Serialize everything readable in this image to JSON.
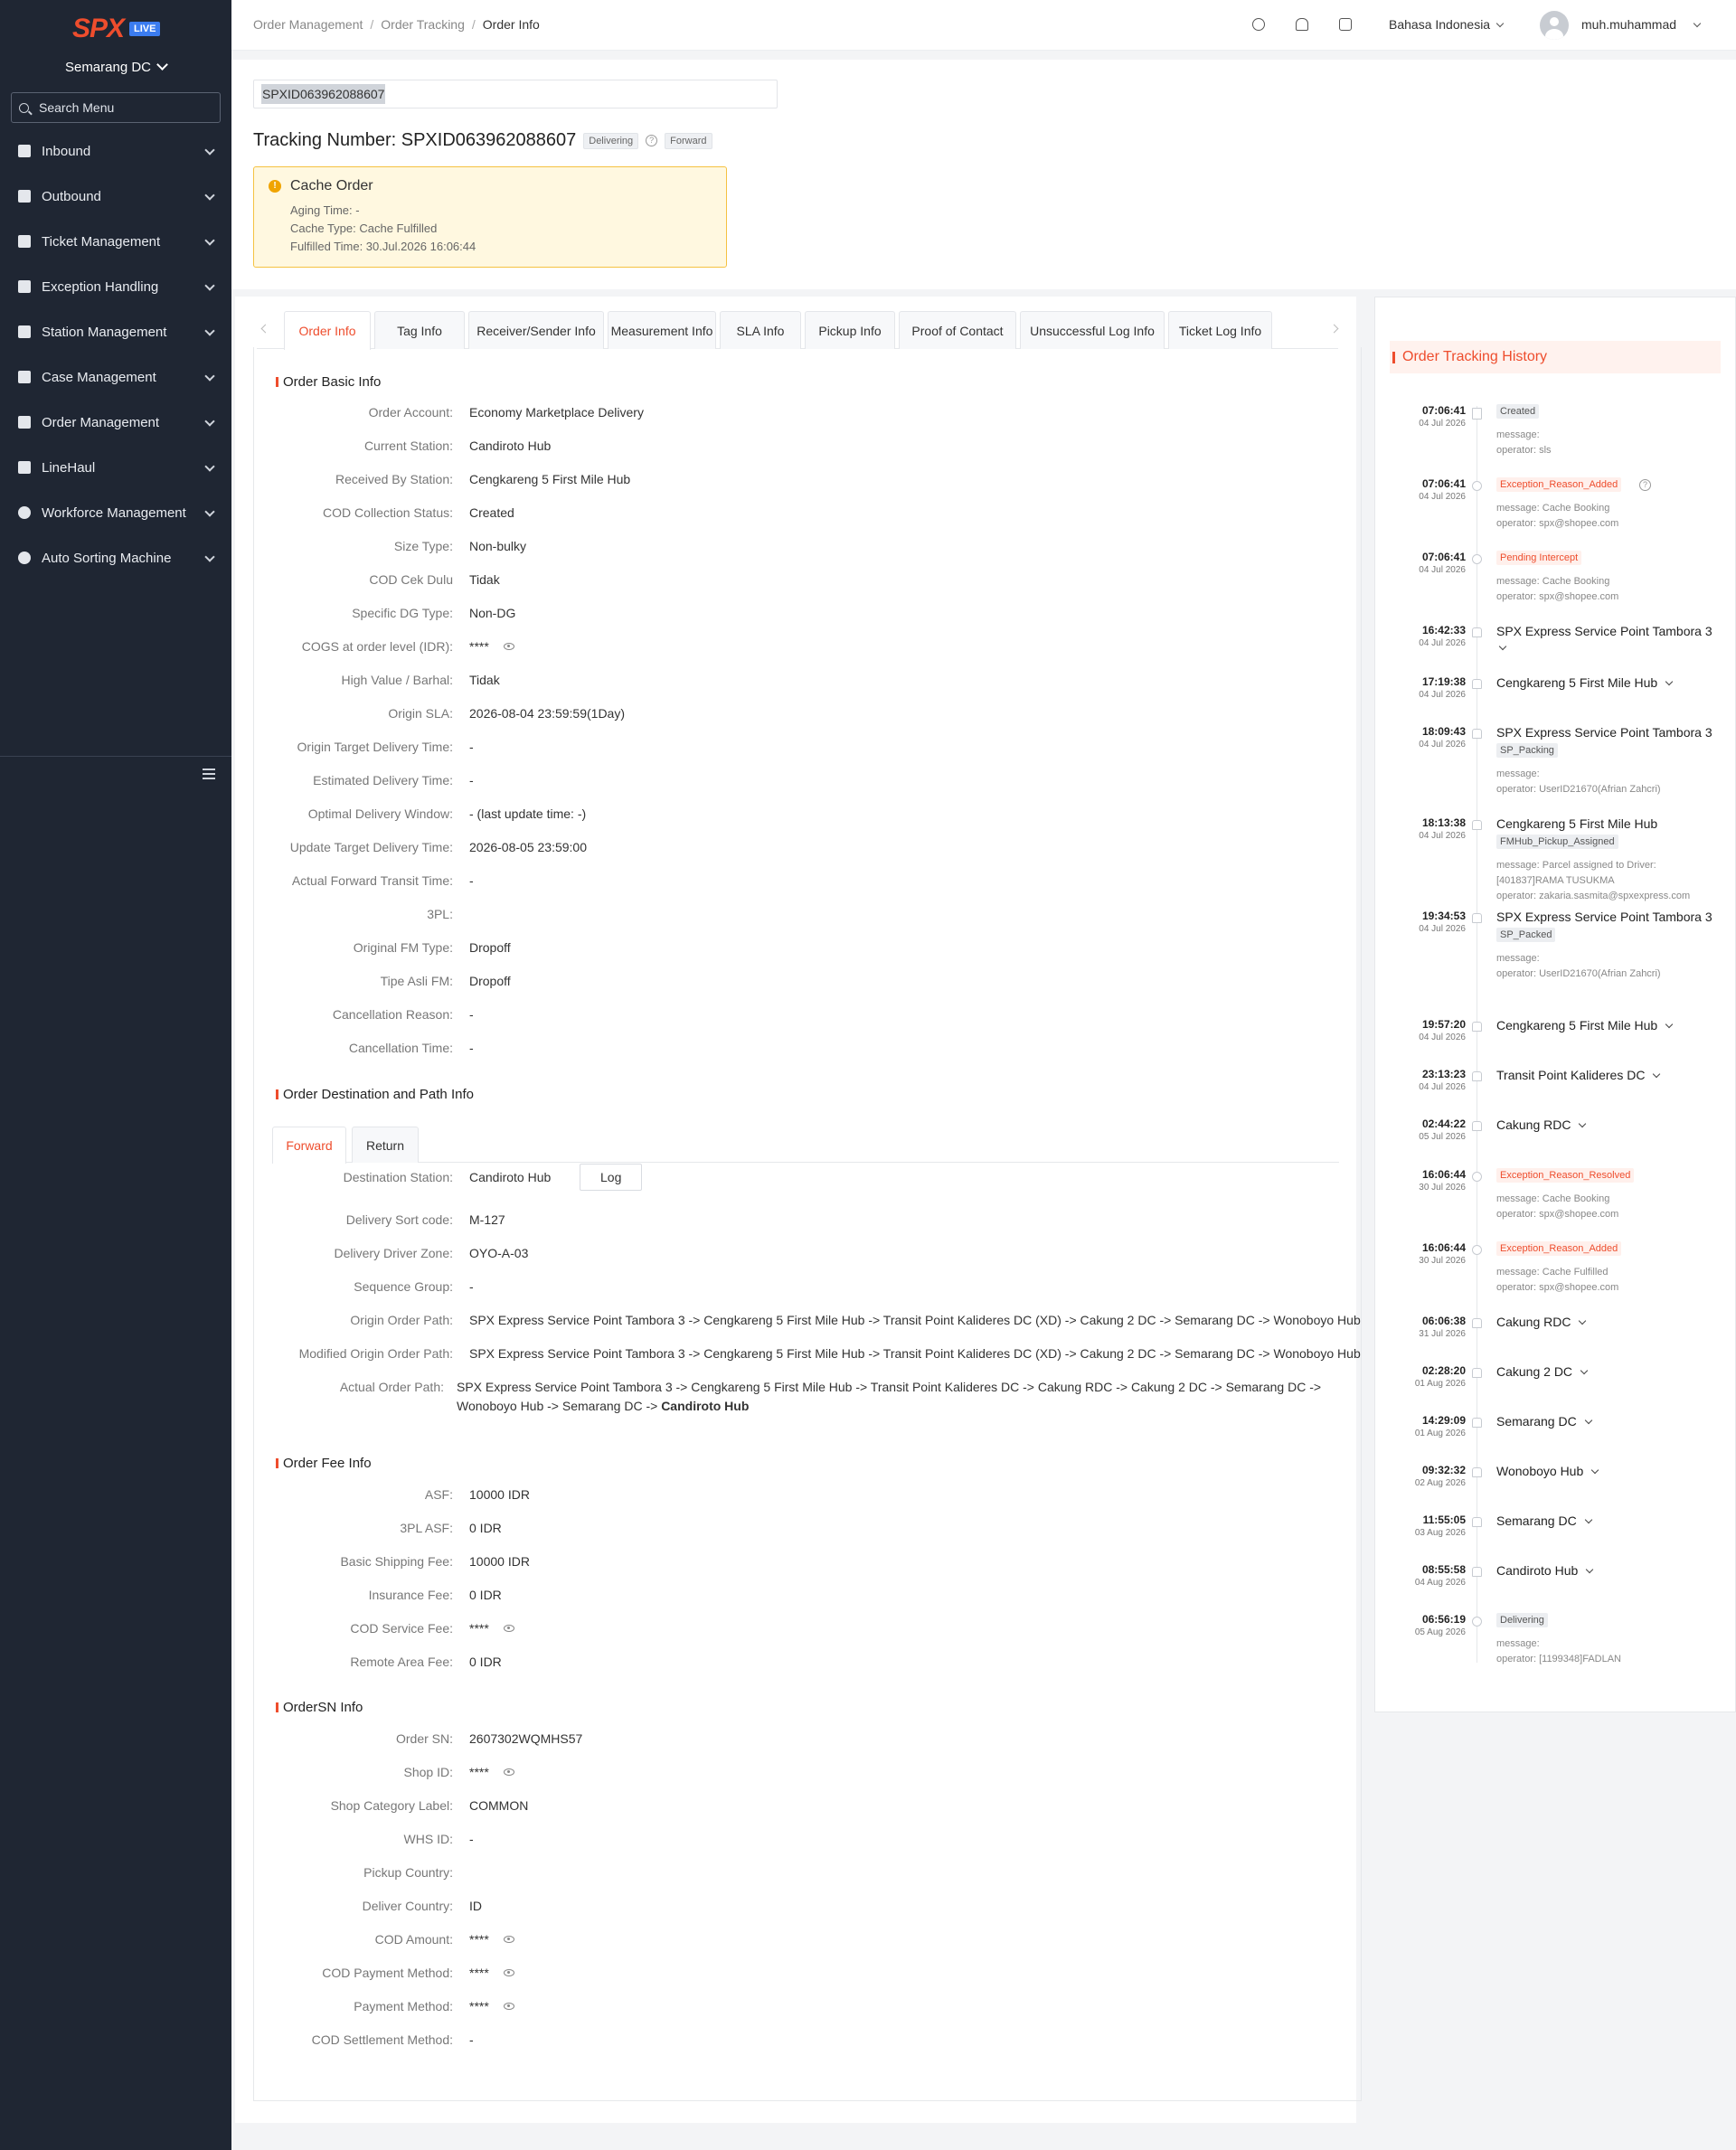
{
  "sidebar": {
    "logo": "SPX",
    "logo_badge": "LIVE",
    "station": "Semarang DC",
    "search_placeholder": "Search Menu",
    "items": [
      {
        "label": "Inbound",
        "icon": "inbound-icon"
      },
      {
        "label": "Outbound",
        "icon": "outbound-icon"
      },
      {
        "label": "Ticket Management",
        "icon": "ticket-icon"
      },
      {
        "label": "Exception Handling",
        "icon": "exception-icon"
      },
      {
        "label": "Station Management",
        "icon": "home-icon"
      },
      {
        "label": "Case Management",
        "icon": "case-icon"
      },
      {
        "label": "Order Management",
        "icon": "order-icon"
      },
      {
        "label": "LineHaul",
        "icon": "truck-icon"
      },
      {
        "label": "Workforce Management",
        "icon": "user-icon"
      },
      {
        "label": "Auto Sorting Machine",
        "icon": "sorting-icon"
      }
    ]
  },
  "topbar": {
    "breadcrumb": [
      "Order Management",
      "Order Tracking",
      "Order Info"
    ],
    "language": "Bahasa Indonesia",
    "username": "muh.muhammad"
  },
  "header": {
    "search_value": "SPXID063962088607",
    "title": "Tracking Number: SPXID063962088607",
    "status_tag": "Delivering",
    "direction_tag": "Forward",
    "cache": {
      "title": "Cache Order",
      "aging": "Aging Time: -",
      "type": "Cache Type: Cache Fulfilled",
      "fulfilled": "Fulfilled Time: 30.Jul.2026 16:06:44"
    }
  },
  "tabs": [
    "Order Info",
    "Tag Info",
    "Receiver/Sender Info",
    "Measurement Info",
    "SLA Info",
    "Pickup Info",
    "Proof of Contact",
    "Unsuccessful Log Info",
    "Ticket Log Info"
  ],
  "basic_info": {
    "title": "Order Basic Info",
    "rows": [
      {
        "label": "Order Account:",
        "value": "Economy Marketplace Delivery"
      },
      {
        "label": "Current Station:",
        "value": "Candiroto Hub"
      },
      {
        "label": "Received By Station:",
        "value": "Cengkareng 5 First Mile Hub"
      },
      {
        "label": "COD Collection Status:",
        "value": "Created"
      },
      {
        "label": "Size Type:",
        "value": "Non-bulky"
      },
      {
        "label": "COD Cek Dulu",
        "value": "Tidak"
      },
      {
        "label": "Specific DG Type:",
        "value": "Non-DG"
      },
      {
        "label": "COGS at order level (IDR):",
        "value": "****",
        "masked": true
      },
      {
        "label": "High Value / Barhal:",
        "value": "Tidak"
      },
      {
        "label": "Origin SLA:",
        "value": "2026-08-04 23:59:59(1Day)"
      },
      {
        "label": "Origin Target Delivery Time:",
        "value": "-"
      },
      {
        "label": "Estimated Delivery Time:",
        "value": "-"
      },
      {
        "label": "Optimal Delivery Window:",
        "value": "- (last update time: -)"
      },
      {
        "label": "Update Target Delivery Time:",
        "value": "2026-08-05 23:59:00"
      },
      {
        "label": "Actual Forward Transit Time:",
        "value": "-"
      },
      {
        "label": "3PL:",
        "value": ""
      },
      {
        "label": "Original FM Type:",
        "value": "Dropoff"
      },
      {
        "label": "Tipe Asli FM:",
        "value": "Dropoff"
      },
      {
        "label": "Cancellation Reason:",
        "value": "-"
      },
      {
        "label": "Cancellation Time:",
        "value": "-"
      }
    ]
  },
  "destination": {
    "title": "Order Destination and Path Info",
    "subtabs": [
      "Forward",
      "Return"
    ],
    "log_button": "Log",
    "rows": [
      {
        "label": "Destination Station:",
        "value": "Candiroto Hub"
      },
      {
        "label": "Delivery Sort code:",
        "value": "M-127"
      },
      {
        "label": "Delivery Driver Zone:",
        "value": "OYO-A-03"
      },
      {
        "label": "Sequence Group:",
        "value": "-"
      },
      {
        "label": "Origin Order Path:",
        "value": "SPX Express Service Point Tambora 3  -> Cengkareng 5 First Mile Hub  -> Transit Point Kalideres DC (XD)  -> Cakung 2 DC  -> Semarang DC  -> Wonoboyo Hub"
      },
      {
        "label": "Modified Origin Order Path:",
        "value": "SPX Express Service Point Tambora 3  -> Cengkareng 5 First Mile Hub  -> Transit Point Kalideres DC (XD)  -> Cakung 2 DC  -> Semarang DC  -> Wonoboyo Hub"
      }
    ],
    "actual_label": "Actual Order Path:",
    "actual_line1": "SPX Express Service Point Tambora 3  -> Cengkareng 5 First Mile Hub  -> Transit Point Kalideres DC  -> Cakung RDC  -> Cakung 2 DC  -> Semarang DC  ->",
    "actual_line2": "Wonoboyo Hub  -> Semarang DC  -> ",
    "actual_last": "Candiroto Hub"
  },
  "fee_info": {
    "title": "Order Fee Info",
    "rows": [
      {
        "label": "ASF:",
        "value": "10000 IDR"
      },
      {
        "label": "3PL ASF:",
        "value": "0 IDR"
      },
      {
        "label": "Basic Shipping Fee:",
        "value": "10000 IDR"
      },
      {
        "label": "Insurance Fee:",
        "value": "0 IDR"
      },
      {
        "label": "COD Service Fee:",
        "value": "****",
        "masked": true
      },
      {
        "label": "Remote Area Fee:",
        "value": "0 IDR"
      }
    ]
  },
  "ordersn_info": {
    "title": "OrderSN Info",
    "rows": [
      {
        "label": "Order SN:",
        "value": "2607302WQMHS57"
      },
      {
        "label": "Shop ID:",
        "value": "****",
        "masked": true
      },
      {
        "label": "Shop Category Label:",
        "value": "COMMON"
      },
      {
        "label": "WHS ID:",
        "value": "-"
      },
      {
        "label": "Pickup Country:",
        "value": ""
      },
      {
        "label": "Deliver Country:",
        "value": "ID"
      },
      {
        "label": "COD Amount:",
        "value": "****",
        "masked": true
      },
      {
        "label": "COD Payment Method:",
        "value": "****",
        "masked": true
      },
      {
        "label": "Payment Method:",
        "value": "****",
        "masked": true
      },
      {
        "label": "COD Settlement Method:",
        "value": "-"
      }
    ]
  },
  "history": {
    "title": "Order Tracking History",
    "events": [
      {
        "time": "07:06:41",
        "date": "04 Jul 2026",
        "badge": "Created",
        "badge_red": false,
        "lines": [
          "message:",
          "operator: sls"
        ]
      },
      {
        "time": "07:06:41",
        "date": "04 Jul 2026",
        "badge": "Exception_Reason_Added",
        "badge_red": true,
        "help": true,
        "lines": [
          "message: Cache Booking",
          "operator: spx@shopee.com"
        ]
      },
      {
        "time": "07:06:41",
        "date": "04 Jul 2026",
        "badge": "Pending Intercept",
        "badge_red": true,
        "lines": [
          "message: Cache Booking",
          "operator: spx@shopee.com"
        ]
      },
      {
        "time": "16:42:33",
        "date": "04 Jul 2026",
        "station": "SPX Express Service Point Tambora 3",
        "chev_below": true
      },
      {
        "time": "17:19:38",
        "date": "04 Jul 2026",
        "station": "Cengkareng 5 First Mile Hub",
        "chev": true
      },
      {
        "time": "18:09:43",
        "date": "04 Jul 2026",
        "station": "SPX Express Service Point Tambora 3",
        "sub_badge": "SP_Packing",
        "lines": [
          "message:",
          "operator: UserID21670(Afrian Zahcri)"
        ]
      },
      {
        "time": "18:13:38",
        "date": "04 Jul 2026",
        "station": "Cengkareng 5 First Mile Hub",
        "sub_badge": "FMHub_Pickup_Assigned",
        "lines": [
          "message: Parcel assigned to Driver:",
          "[401837]RAMA TUSUKMA",
          "operator: zakaria.sasmita@spxexpress.com"
        ]
      },
      {
        "time": "19:34:53",
        "date": "04 Jul 2026",
        "station": "SPX Express Service Point Tambora 3",
        "sub_badge": "SP_Packed",
        "lines": [
          "message:",
          "operator: UserID21670(Afrian Zahcri)"
        ]
      },
      {
        "time": "19:57:20",
        "date": "04 Jul 2026",
        "station": "Cengkareng 5 First Mile Hub",
        "chev": true
      },
      {
        "time": "23:13:23",
        "date": "04 Jul 2026",
        "station": "Transit Point Kalideres DC",
        "chev": true
      },
      {
        "time": "02:44:22",
        "date": "05 Jul 2026",
        "station": "Cakung RDC",
        "chev": true
      },
      {
        "time": "16:06:44",
        "date": "30 Jul 2026",
        "badge": "Exception_Reason_Resolved",
        "badge_red": true,
        "lines": [
          "message: Cache Booking",
          "operator: spx@shopee.com"
        ]
      },
      {
        "time": "16:06:44",
        "date": "30 Jul 2026",
        "badge": "Exception_Reason_Added",
        "badge_red": true,
        "lines": [
          "message: Cache Fulfilled",
          "operator: spx@shopee.com"
        ]
      },
      {
        "time": "06:06:38",
        "date": "31 Jul 2026",
        "station": "Cakung RDC",
        "chev": true
      },
      {
        "time": "02:28:20",
        "date": "01 Aug 2026",
        "station": "Cakung 2 DC",
        "chev": true
      },
      {
        "time": "14:29:09",
        "date": "01 Aug 2026",
        "station": "Semarang DC",
        "chev": true
      },
      {
        "time": "09:32:32",
        "date": "02 Aug 2026",
        "station": "Wonoboyo Hub",
        "chev": true
      },
      {
        "time": "11:55:05",
        "date": "03 Aug 2026",
        "station": "Semarang DC",
        "chev": true
      },
      {
        "time": "08:55:58",
        "date": "04 Aug 2026",
        "station": "Candiroto Hub",
        "chev": true
      },
      {
        "time": "06:56:19",
        "date": "05 Aug 2026",
        "badge": "Delivering",
        "badge_red": false,
        "lines": [
          "message:",
          "operator: [1199348]FADLAN"
        ]
      }
    ]
  }
}
